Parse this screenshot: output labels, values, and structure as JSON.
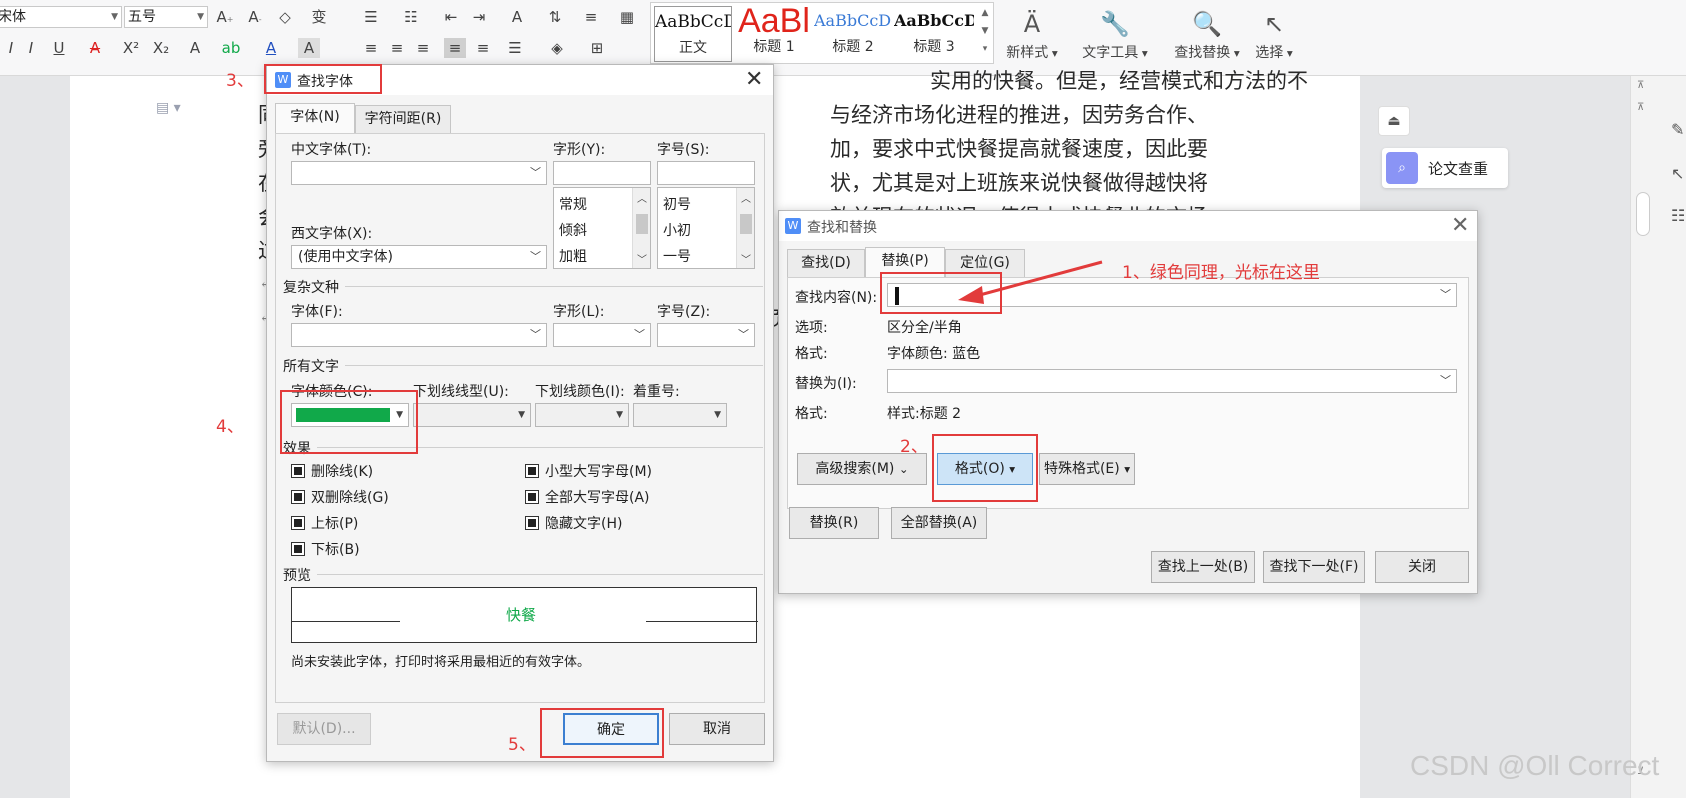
{
  "ribbon": {
    "font_name": "宋体",
    "font_size": "五号",
    "styles": [
      {
        "sample": "AaBbCcDd",
        "name": "正文",
        "color": "#111111"
      },
      {
        "sample": "AaBl",
        "name": "标题 1",
        "color": "#e0241b"
      },
      {
        "sample": "AaBbCcDd",
        "name": "标题 2",
        "color": "#3b7bd6"
      },
      {
        "sample": "AaBbCcDd",
        "name": "标题 3",
        "color": "#111111"
      }
    ],
    "new_style": "新样式",
    "text_tools": "文字工具",
    "find_replace": "查找替换",
    "select": "选择"
  },
  "document": {
    "lines": [
      "实用的快餐。但是，经营模式和方法的不",
      "与经济市场化进程的推进，因劳务合作、",
      "加，要求中式快餐提高就餐速度，因此要",
      "状，尤其是对上班族来说快餐做得越快将",
      "效益现在的状况，使得中式快餐业的市场"
    ],
    "left_chars": [
      "同",
      "旁",
      "在",
      "会",
      "过"
    ],
    "para_mark": "↵",
    "fragment": "页"
  },
  "side_panel": {
    "paper_check": "论文查重"
  },
  "watermark": "CSDN @Oll Correct",
  "find_font": {
    "title": "查找字体",
    "tabs": [
      "字体(N)",
      "字符间距(R)"
    ],
    "chinese_font_label": "中文字体(T):",
    "chinese_font_value": "",
    "style_label": "字形(Y):",
    "size_label": "字号(S):",
    "style_items": [
      "常规",
      "倾斜",
      "加粗"
    ],
    "size_items": [
      "初号",
      "小初",
      "一号"
    ],
    "western_font_label": "西文字体(X):",
    "western_font_value": "(使用中文字体)",
    "complex_section": "复杂文种",
    "complex_font_label": "字体(F):",
    "complex_style_label": "字形(L):",
    "complex_size_label": "字号(Z):",
    "all_text_section": "所有文字",
    "font_color_label": "字体颜色(C):",
    "font_color_value": "#11a94a",
    "underline_type_label": "下划线线型(U):",
    "underline_color_label": "下划线颜色(I):",
    "emphasis_label": "着重号:",
    "effects_section": "效果",
    "effects_left": [
      "删除线(K)",
      "双删除线(G)",
      "上标(P)",
      "下标(B)"
    ],
    "effects_right": [
      "小型大写字母(M)",
      "全部大写字母(A)",
      "隐藏文字(H)"
    ],
    "preview_section": "预览",
    "preview_text": "快餐",
    "note": "尚未安装此字体，打印时将采用最相近的有效字体。",
    "default_button": "默认(D)...",
    "ok_button": "确定",
    "cancel_button": "取消"
  },
  "find_replace": {
    "title": "查找和替换",
    "tabs": [
      "查找(D)",
      "替换(P)",
      "定位(G)"
    ],
    "find_label": "查找内容(N):",
    "find_value": "",
    "options_label": "选项:",
    "options_value": "区分全/半角",
    "format_label": "格式:",
    "format_find_value": "字体颜色: 蓝色",
    "replace_label": "替换为(I):",
    "replace_value": "",
    "format_replace_value": "样式:标题 2",
    "advanced_button": "高级搜索(M)",
    "format_button": "格式(O)",
    "special_button": "特殊格式(E)",
    "replace_button": "替换(R)",
    "replace_all_button": "全部替换(A)",
    "find_prev_button": "查找上一处(B)",
    "find_next_button": "查找下一处(F)",
    "close_button": "关闭"
  },
  "annotations": {
    "step1": "1、绿色同理，光标在这里",
    "step2": "2、",
    "step3": "3、",
    "step4": "4、",
    "step5": "5、"
  }
}
